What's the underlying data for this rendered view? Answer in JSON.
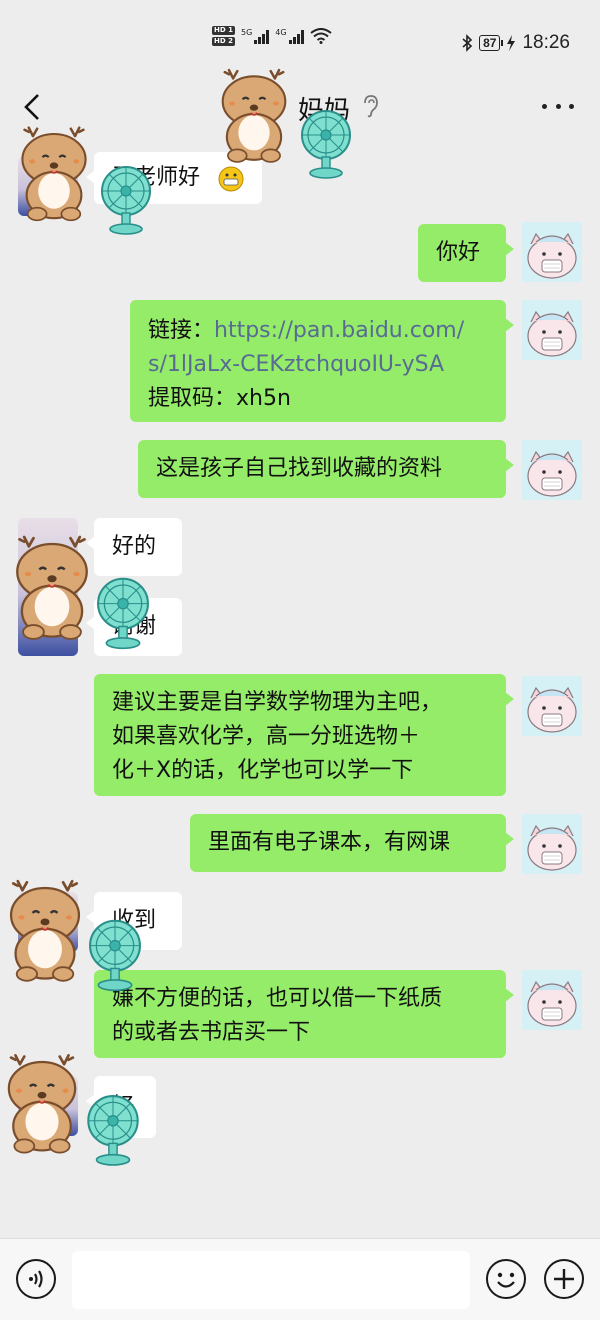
{
  "status_bar": {
    "hd1": "HD 1",
    "hd2": "HD 2",
    "net1": "5G",
    "net2": "4G",
    "battery": "87",
    "time": "18:26"
  },
  "header": {
    "title": "妈妈"
  },
  "messages": [
    {
      "sender": "other",
      "text": "王老师好"
    },
    {
      "sender": "self",
      "text": "你好"
    },
    {
      "sender": "self",
      "label": "链接：",
      "url_line1": "https://pan.baidu.com/",
      "url_line2": "s/1lJaLx-CEKztchquoIU-ySA",
      "code": "提取码：xh5n"
    },
    {
      "sender": "self",
      "text": "这是孩子自己找到收藏的资料"
    },
    {
      "sender": "other",
      "text": "好的"
    },
    {
      "sender": "other",
      "text": "谢谢"
    },
    {
      "sender": "self",
      "line1": "建议主要是自学数学物理为主吧，",
      "line2": "如果喜欢化学，高一分班选物＋",
      "line3": "化＋X的话，化学也可以学一下"
    },
    {
      "sender": "self",
      "text": "里面有电子课本，有网课"
    },
    {
      "sender": "other",
      "text": "收到"
    },
    {
      "sender": "self",
      "line1": "嫌不方便的话，也可以借一下纸质",
      "line2": "的或者去书店买一下"
    },
    {
      "sender": "other",
      "text": "好"
    }
  ],
  "input": {
    "value": ""
  },
  "colors": {
    "background": "#ededed",
    "bubble_self": "#95ec69",
    "bubble_other": "#ffffff",
    "link": "#576b95"
  },
  "icons": [
    "back-arrow-icon",
    "ear-icon",
    "more-icon",
    "voice-icon",
    "emoji-icon",
    "plus-icon",
    "bear-sticker",
    "fan-sticker",
    "pig-avatar"
  ]
}
